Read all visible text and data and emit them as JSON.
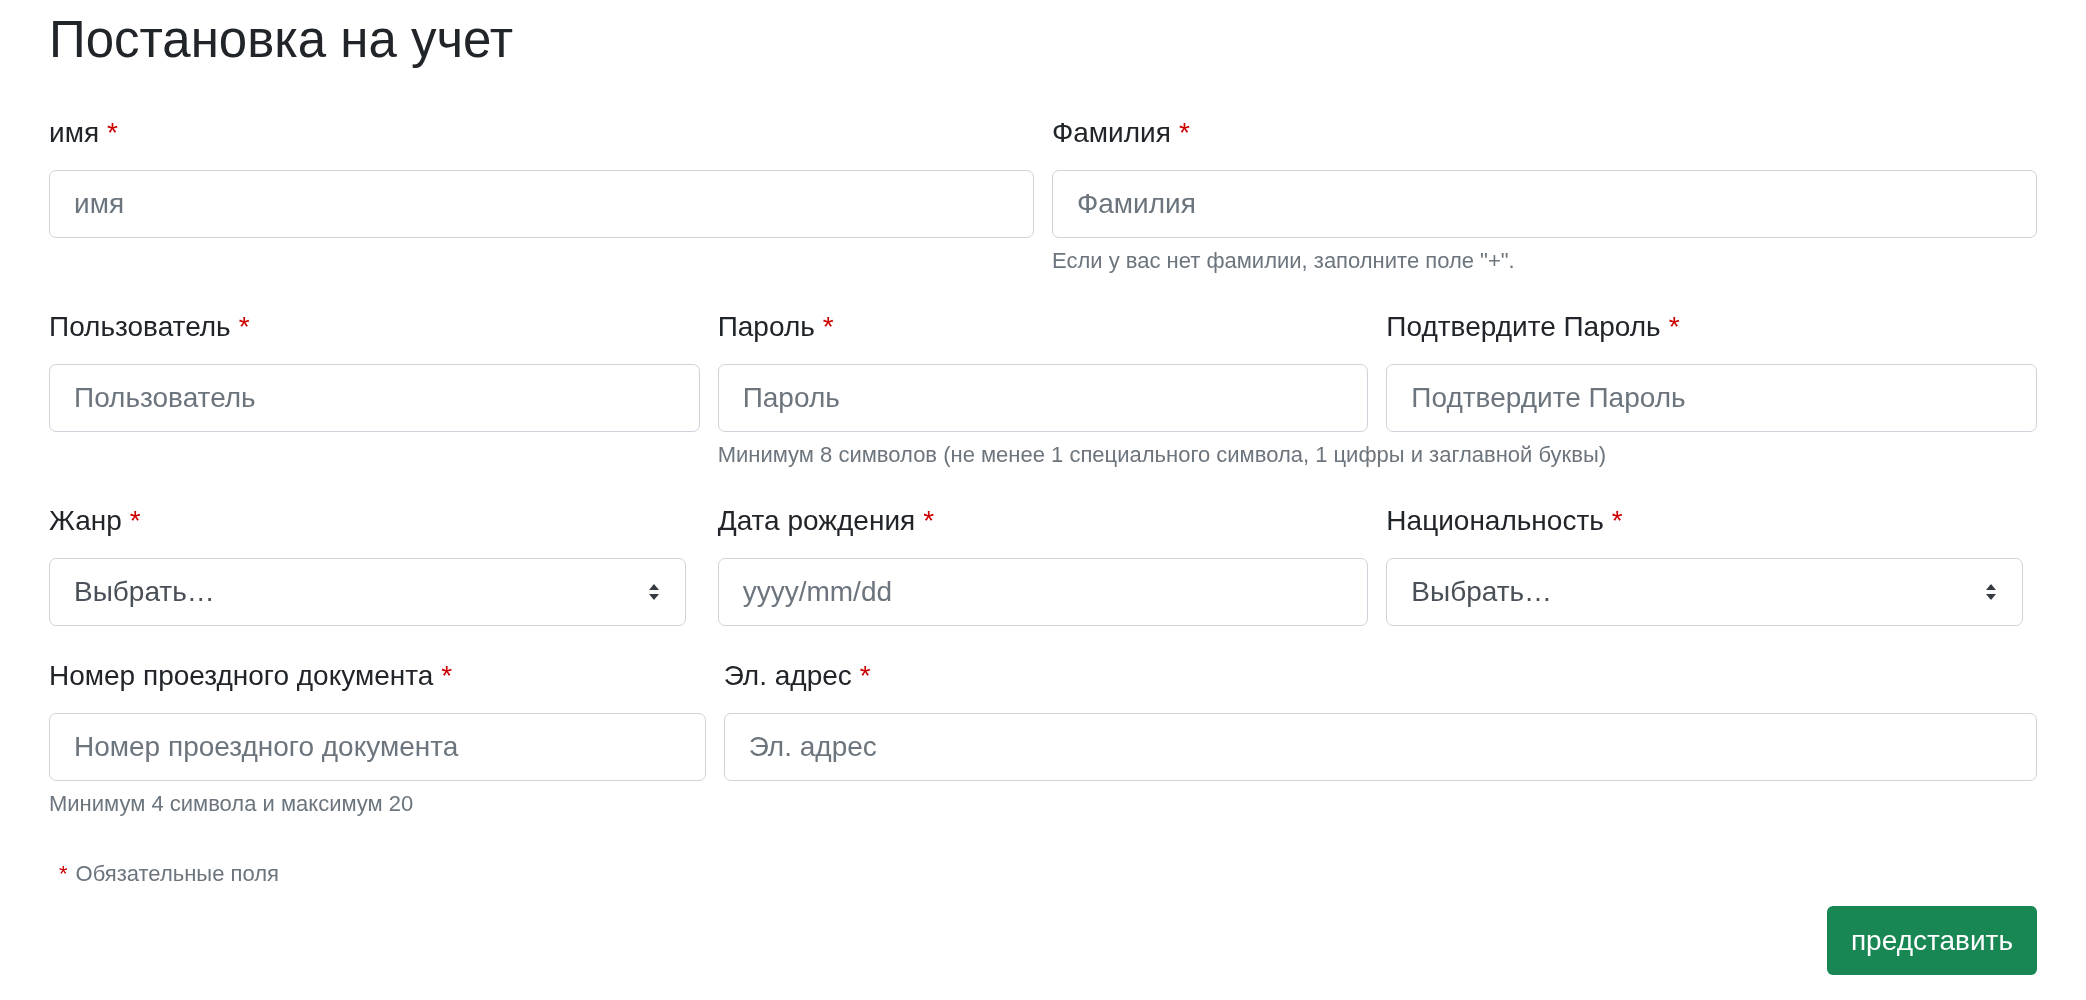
{
  "title": "Постановка на учет",
  "rows": [
    {
      "fields": [
        {
          "kind": "text",
          "label": "имя",
          "required_mark": "*",
          "placeholder": "имя"
        },
        {
          "kind": "text",
          "label": "Фамилия",
          "required_mark": "*",
          "placeholder": "Фамилия",
          "help": "Если у вас нет фамилии, заполните поле \"+\"."
        }
      ]
    },
    {
      "fields": [
        {
          "kind": "text",
          "label": "Пользователь",
          "required_mark": "*",
          "placeholder": "Пользователь"
        },
        {
          "kind": "password",
          "label": "Пароль",
          "required_mark": "*",
          "placeholder": "Пароль",
          "help": "Минимум 8 символов (не менее 1 специального символа, 1 цифры и заглавной буквы)"
        },
        {
          "kind": "password",
          "label": "Подтвердите Пароль",
          "required_mark": "*",
          "placeholder": "Подтвердите Пароль"
        }
      ]
    },
    {
      "fields": [
        {
          "kind": "select",
          "label": "Жанр",
          "required_mark": "*",
          "value": "Выбрать…"
        },
        {
          "kind": "date",
          "label": "Дата рождения",
          "required_mark": "*",
          "placeholder": "yyyy/mm/dd"
        },
        {
          "kind": "select",
          "label": "Национальность",
          "required_mark": "*",
          "value": "Выбрать…"
        }
      ]
    },
    {
      "fields": [
        {
          "kind": "text",
          "label": "Номер проездного документа",
          "required_mark": "*",
          "placeholder": "Номер проездного документа",
          "help": "Минимум 4 символа и максимум 20"
        },
        {
          "kind": "email",
          "label": "Эл. адрес",
          "required_mark": "*",
          "placeholder": "Эл. адрес"
        }
      ]
    }
  ],
  "required_note": {
    "mark": "*",
    "text": "Обязательные поля"
  },
  "submit_button": "представить"
}
